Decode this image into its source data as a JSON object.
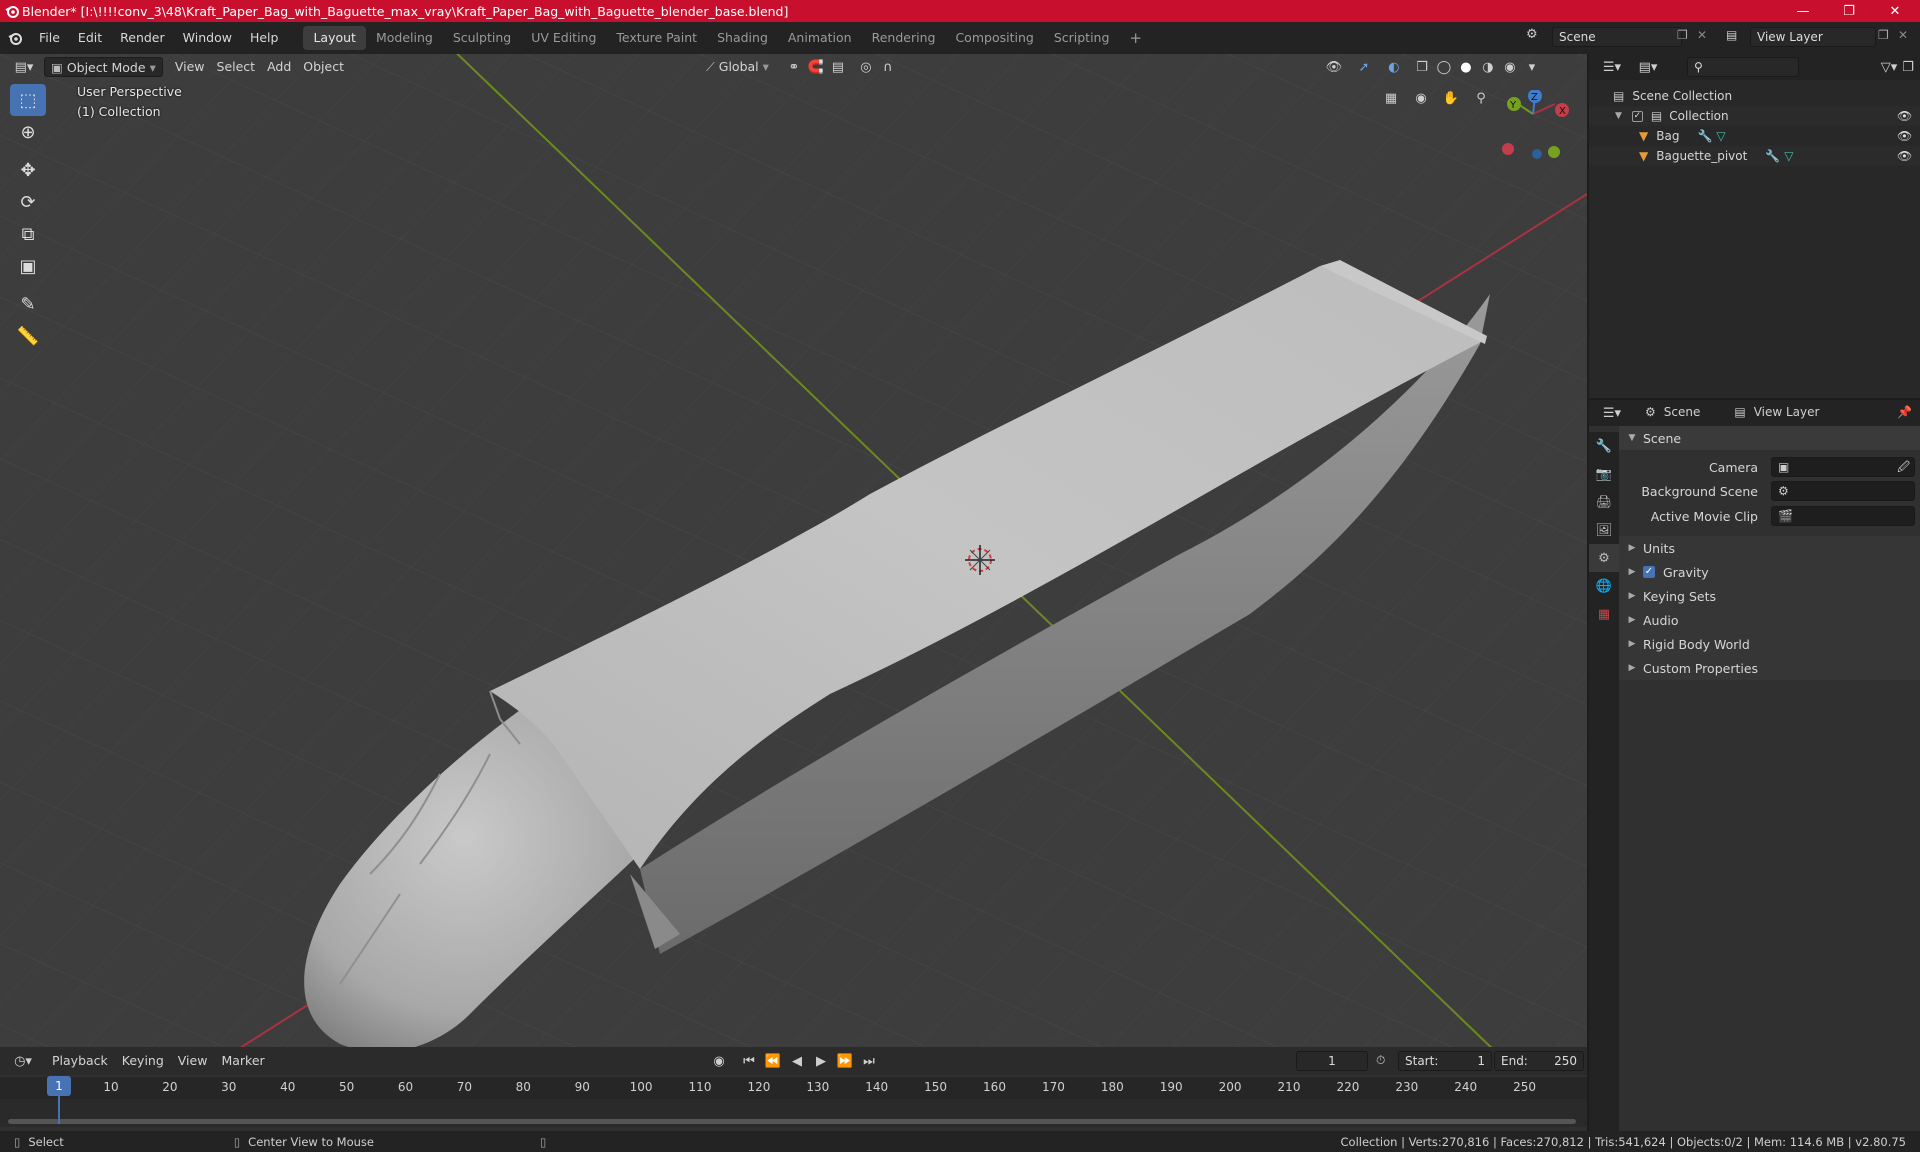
{
  "window": {
    "title": "Blender* [I:\\!!!!conv_3\\48\\Kraft_Paper_Bag_with_Baguette_max_vray\\Kraft_Paper_Bag_with_Baguette_blender_base.blend]",
    "controls": [
      "minimize-icon",
      "maximize-icon",
      "close-icon"
    ]
  },
  "menu": {
    "items": [
      "File",
      "Edit",
      "Render",
      "Window",
      "Help"
    ]
  },
  "workspaces": {
    "tabs": [
      "Layout",
      "Modeling",
      "Sculpting",
      "UV Editing",
      "Texture Paint",
      "Shading",
      "Animation",
      "Rendering",
      "Compositing",
      "Scripting"
    ],
    "active": "Layout",
    "add": "+"
  },
  "scene_selector": {
    "value": "Scene"
  },
  "view_layer_selector": {
    "value": "View Layer"
  },
  "viewport": {
    "mode": "Object Mode",
    "menus": [
      "View",
      "Select",
      "Add",
      "Object"
    ],
    "orientation": "Global",
    "info_line1": "User Perspective",
    "info_line2": "(1) Collection",
    "gizmo_axes": [
      "X",
      "Y",
      "Z"
    ],
    "colors": {
      "x_axis": "#a8333f",
      "y_axis": "#6b9a1e",
      "z_axis": "#3d7fce",
      "bg": "#3d3d3d"
    }
  },
  "outliner": {
    "root": "Scene Collection",
    "collection": "Collection",
    "objects": [
      "Bag",
      "Baguette_pivot"
    ],
    "search_placeholder": ""
  },
  "properties": {
    "tabs": [
      "Scene",
      "View Layer"
    ],
    "panel_title": "Scene",
    "fields": {
      "camera": "Camera",
      "background_scene": "Background Scene",
      "active_movie_clip": "Active Movie Clip"
    },
    "sections": [
      "Units",
      "Gravity",
      "Keying Sets",
      "Audio",
      "Rigid Body World",
      "Custom Properties"
    ],
    "gravity_checked": true
  },
  "timeline": {
    "menus": [
      "Playback",
      "Keying",
      "View",
      "Marker"
    ],
    "current_frame": "1",
    "start_label": "Start:",
    "start": "1",
    "end_label": "End:",
    "end": "250",
    "ruler": [
      "1",
      "10",
      "20",
      "30",
      "40",
      "50",
      "60",
      "70",
      "80",
      "90",
      "100",
      "110",
      "120",
      "130",
      "140",
      "150",
      "160",
      "170",
      "180",
      "190",
      "200",
      "210",
      "220",
      "230",
      "240",
      "250"
    ]
  },
  "statusbar": {
    "select": "Select",
    "center_view": "Center View to Mouse",
    "stats": "Collection | Verts:270,816 | Faces:270,812 | Tris:541,624 | Objects:0/2 | Mem: 114.6 MB | v2.80.75"
  }
}
